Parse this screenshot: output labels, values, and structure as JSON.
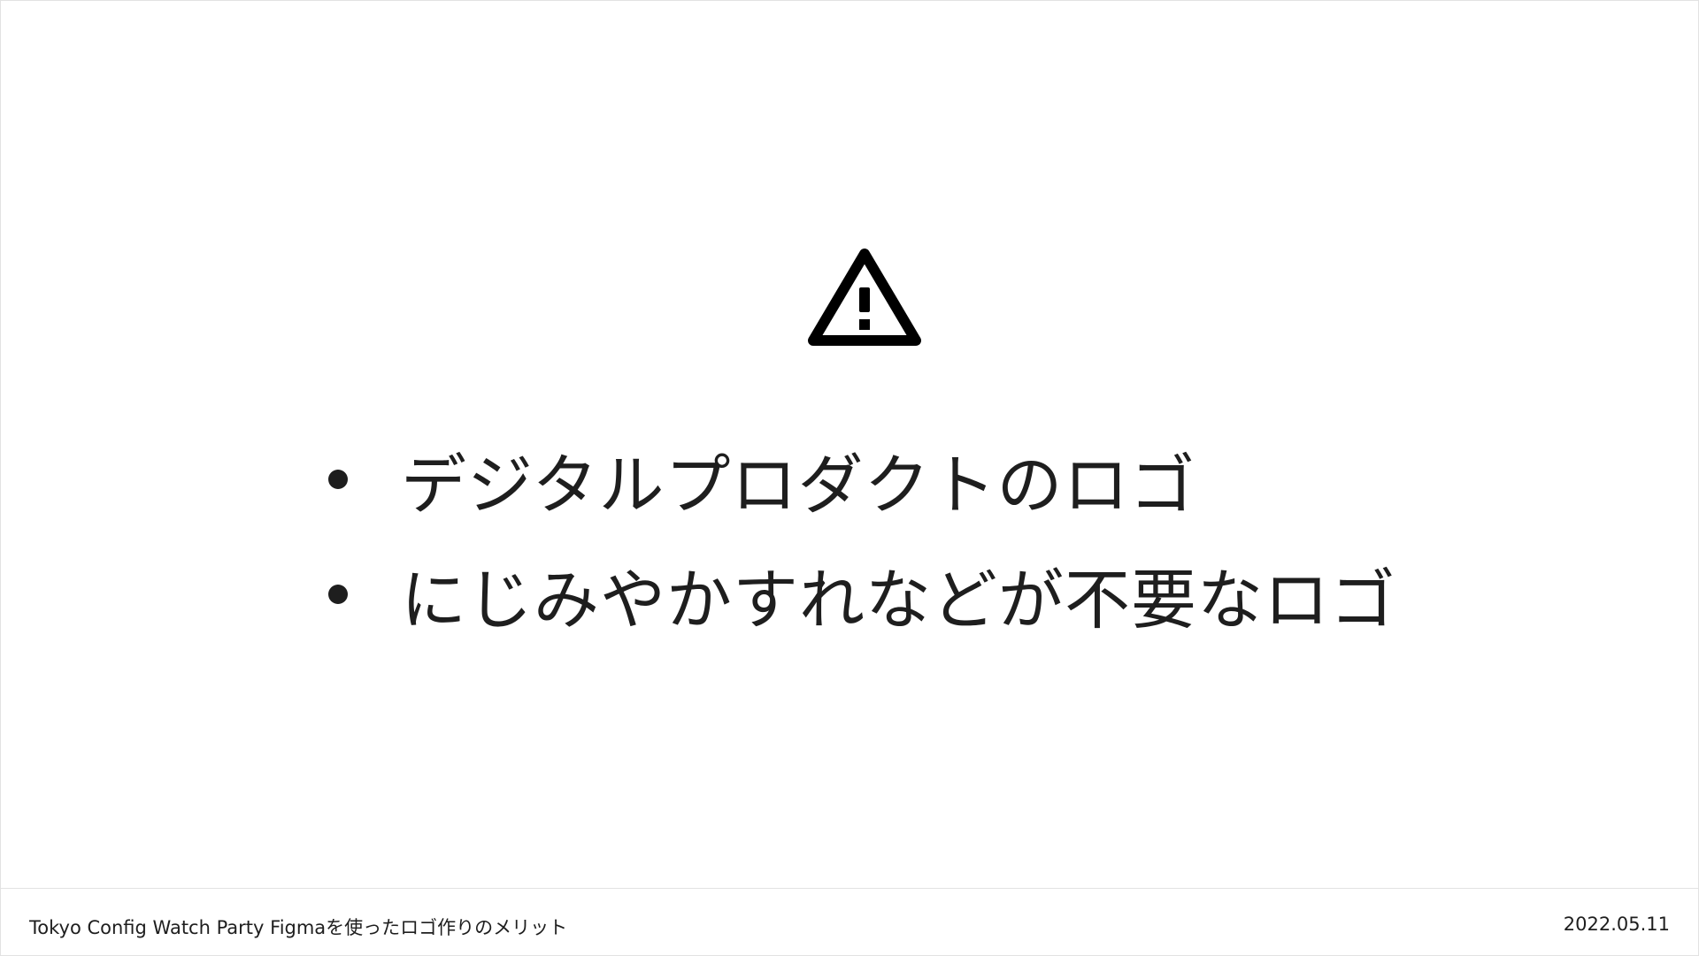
{
  "slide": {
    "icon": "warning-triangle-icon",
    "bullets": [
      "デジタルプロダクトのロゴ",
      "にじみやかすれなどが不要なロゴ"
    ]
  },
  "footer": {
    "title": "Tokyo Config Watch Party Figmaを使ったロゴ作りのメリット",
    "date": "2022.05.11"
  },
  "colors": {
    "text": "#1e1e1e",
    "background": "#ffffff",
    "border": "#e2e2e2"
  }
}
